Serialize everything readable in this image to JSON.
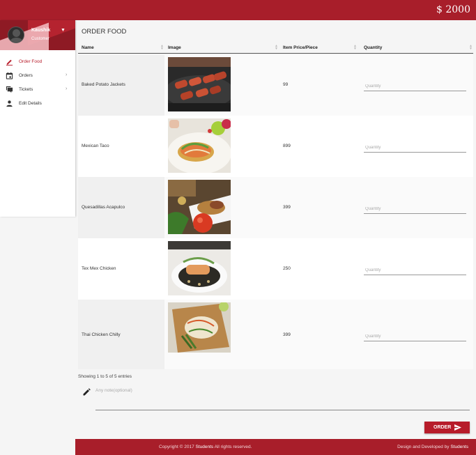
{
  "header": {
    "balance": "$ 2000"
  },
  "sidebar": {
    "user": {
      "name": "Kaushik",
      "role": "Customer"
    },
    "items": [
      {
        "label": "Order Food",
        "icon": "pencil-icon",
        "active": true
      },
      {
        "label": "Orders",
        "icon": "calendar-icon",
        "arrow": "›"
      },
      {
        "label": "Tickets",
        "icon": "chat-icon",
        "arrow": "›"
      },
      {
        "label": "Edit Details",
        "icon": "person-icon"
      }
    ]
  },
  "page": {
    "title": "ORDER FOOD"
  },
  "table": {
    "columns": [
      "Name",
      "Image",
      "Item Price/Piece",
      "Quantity"
    ],
    "rows": [
      {
        "name": "Baked Potato Jackets",
        "image": "grilled-meat-skillet-photo",
        "price": "99",
        "quantity_placeholder": "Quantity"
      },
      {
        "name": "Mexican Taco",
        "image": "tostada-plate-photo",
        "price": "899",
        "quantity_placeholder": "Quantity"
      },
      {
        "name": "Quesadillas Acapulco",
        "image": "quesadilla-plate-photo",
        "price": "399",
        "quantity_placeholder": "Quantity"
      },
      {
        "name": "Tex Mex Chicken",
        "image": "chicken-bowl-photo",
        "price": "250",
        "quantity_placeholder": "Quantity"
      },
      {
        "name": "Thai Chicken Chilly",
        "image": "chicken-board-photo",
        "price": "399",
        "quantity_placeholder": "Quantity"
      }
    ]
  },
  "showing": "Showing 1 to 5 of 5 entries",
  "note": {
    "placeholder": "Any note(optional)"
  },
  "order_button": "ORDER",
  "footer": {
    "copyright_prefix": "Copyright © 2017",
    "copyright_brand": "Students",
    "copyright_suffix": "All rights reserved.",
    "credit_prefix": "Design and Developed by",
    "credit_brand": "Students"
  },
  "colors": {
    "brand": "#a81e2a",
    "accent": "#b71c2a",
    "sort_active": "#5b6fd6"
  }
}
